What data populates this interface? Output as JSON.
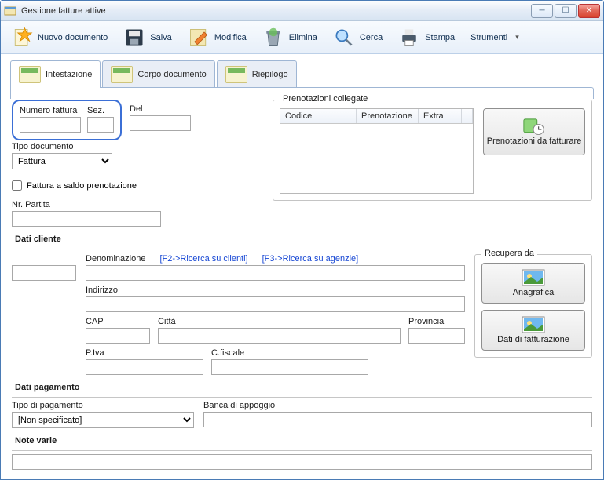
{
  "window": {
    "title": "Gestione fatture attive"
  },
  "toolbar": {
    "nuovo": "Nuovo documento",
    "salva": "Salva",
    "modifica": "Modifica",
    "elimina": "Elimina",
    "cerca": "Cerca",
    "stampa": "Stampa",
    "strumenti": "Strumenti"
  },
  "tabs": {
    "intestazione": "Intestazione",
    "corpo": "Corpo documento",
    "riepilogo": "Riepilogo"
  },
  "intest": {
    "numero_label": "Numero fattura",
    "sez_label": "Sez.",
    "del_label": "Del",
    "tipo_doc_label": "Tipo documento",
    "tipo_doc_value": "Fattura",
    "fattura_saldo": "Fattura a saldo prenotazione",
    "nr_partita": "Nr. Partita"
  },
  "prenotazioni": {
    "legend": "Prenotazioni collegate",
    "col_codice": "Codice",
    "col_prenotazione": "Prenotazione",
    "col_extra": "Extra",
    "btn": "Prenotazioni da fatturare"
  },
  "cliente": {
    "section": "Dati cliente",
    "denominazione": "Denominazione",
    "f2": "[F2->Ricerca su clienti]",
    "f3": "[F3->Ricerca su agenzie]",
    "indirizzo": "Indirizzo",
    "cap": "CAP",
    "citta": "Città",
    "provincia": "Provincia",
    "piva": "P.Iva",
    "cfiscale": "C.fiscale"
  },
  "recupera": {
    "legend": "Recupera da",
    "anagrafica": "Anagrafica",
    "fatturazione": "Dati di fatturazione"
  },
  "pagamento": {
    "section": "Dati pagamento",
    "tipo": "Tipo di pagamento",
    "tipo_value": "[Non specificato]",
    "banca": "Banca di appoggio"
  },
  "note": {
    "section": "Note varie"
  }
}
